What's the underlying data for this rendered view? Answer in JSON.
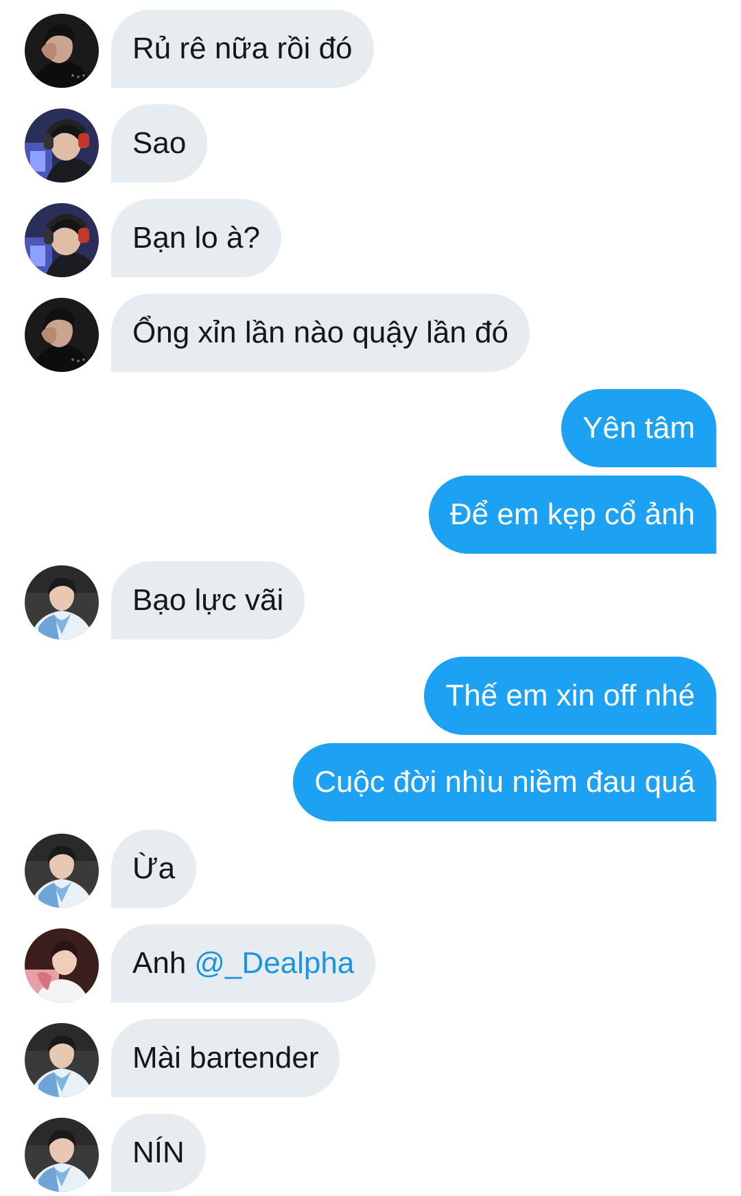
{
  "conversation": {
    "messages": [
      {
        "direction": "in",
        "avatar": "avatar-dark-hand",
        "text": "Rủ rê nữa rồi đó"
      },
      {
        "direction": "in",
        "avatar": "avatar-headset",
        "text": "Sao"
      },
      {
        "direction": "in",
        "avatar": "avatar-headset",
        "text": "Bạn lo à?"
      },
      {
        "direction": "in",
        "avatar": "avatar-dark-hand",
        "text": "Ổng xỉn lần nào quậy lần đó"
      },
      {
        "direction": "out",
        "text": "Yên tâm"
      },
      {
        "direction": "out",
        "text": "Để em kẹp cổ ảnh"
      },
      {
        "direction": "in",
        "avatar": "avatar-hanbok",
        "text": "Bạo lực vãi"
      },
      {
        "direction": "out",
        "text": "Thế em xin off nhé"
      },
      {
        "direction": "out",
        "text": "Cuộc đời nhìu niềm đau quá"
      },
      {
        "direction": "in",
        "avatar": "avatar-hanbok",
        "text": "Ừa"
      },
      {
        "direction": "in",
        "avatar": "avatar-pink",
        "text": "Anh",
        "mention": "@_Dealpha"
      },
      {
        "direction": "in",
        "avatar": "avatar-hanbok",
        "text": "Mài bartender"
      },
      {
        "direction": "in",
        "avatar": "avatar-hanbok",
        "text": "NÍN"
      }
    ]
  },
  "colors": {
    "incoming_bubble": "#e6ecf0",
    "incoming_text": "#14171a",
    "outgoing_bubble": "#1da1f2",
    "outgoing_text": "#ffffff",
    "mention": "#1b95e0"
  }
}
